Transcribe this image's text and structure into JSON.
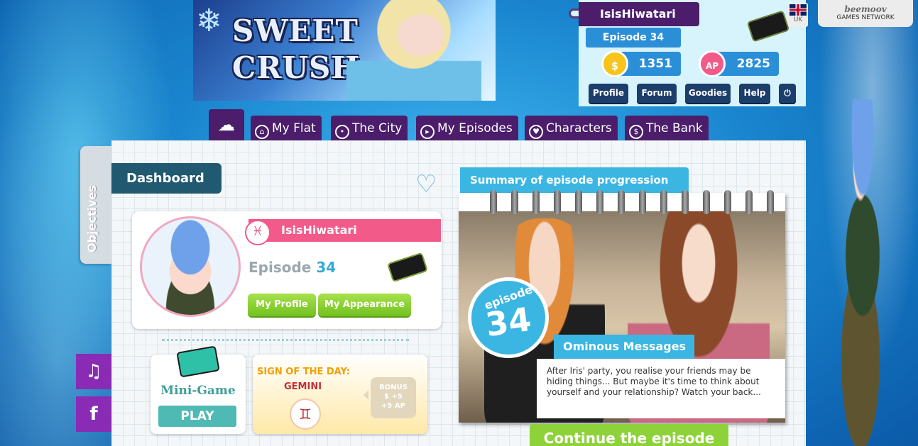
{
  "logo": {
    "line1": "SWEET",
    "line2": "CRUSH"
  },
  "account": {
    "username": "IsisHiwatari",
    "episode": "Episode 34",
    "dollars": "1351",
    "ap": "2825",
    "buttons": [
      "Profile",
      "Forum",
      "Goodies",
      "Help"
    ],
    "power_icon": "power-icon",
    "coin_symbol": "$",
    "ap_symbol": "AP"
  },
  "lang": {
    "code": "UK"
  },
  "network": {
    "brand": "beemoov",
    "label": "GAMES NETWORK"
  },
  "nav": {
    "home_icon": "cupcake-home-icon",
    "tabs": [
      {
        "label": "My Flat",
        "icon": "house-icon"
      },
      {
        "label": "The City",
        "icon": "map-pin-icon"
      },
      {
        "label": "My Episodes",
        "icon": "play-icon"
      },
      {
        "label": "Characters",
        "icon": "heart-icon"
      },
      {
        "label": "The Bank",
        "icon": "dollar-icon"
      }
    ]
  },
  "objectives": {
    "label": "Objectives"
  },
  "dashboard": {
    "title": "Dashboard",
    "profile": {
      "name": "IsisHiwatari",
      "zodiac_glyph": "♓",
      "episode_prefix": "Episode",
      "episode_num": "34",
      "btn_profile": "My Profile",
      "btn_appearance": "My Appearance"
    },
    "minigame": {
      "label": "Mini-Game",
      "play": "PLAY"
    },
    "sign": {
      "title": "SIGN OF THE DAY:",
      "name": "GEMINI",
      "glyph": "♊",
      "bonus_title": "BONUS",
      "bonus_dollars": "$ +5",
      "bonus_ap": "+5 AP"
    }
  },
  "summary": {
    "title": "Summary of episode progression",
    "episode_word": "episode",
    "episode_num": "34",
    "episode_title": "Ominous Messages",
    "description": "After Iris' party, you realise your friends may be hiding things... But maybe it's time to think about yourself and your relationship? Watch your back...",
    "continue": "Continue the episode"
  },
  "social": {
    "music": "♫",
    "facebook": "f"
  },
  "colors": {
    "nav": "#4b1d6b",
    "accent": "#3bb6e3",
    "pink": "#f25a8a",
    "green": "#8ed23a"
  }
}
